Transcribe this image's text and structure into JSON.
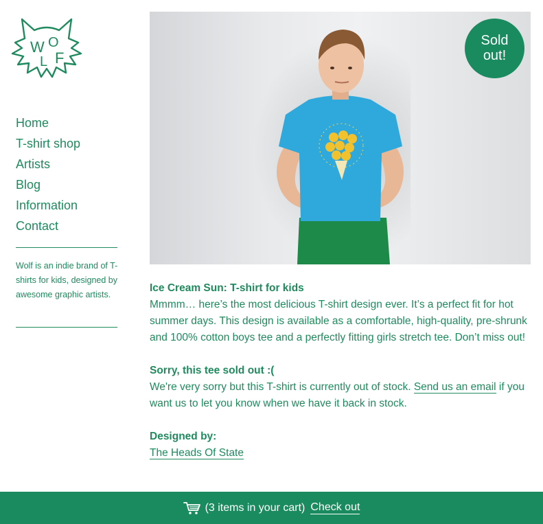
{
  "brand": {
    "logo_text": "WOLF",
    "logo_letters": [
      "W",
      "O",
      "L",
      "F"
    ],
    "tagline": "Wolf is an indie brand of T-shirts for kids, designed by awesome graphic artists.",
    "accent_color": "#1a8a5f"
  },
  "nav": {
    "items": [
      {
        "label": "Home"
      },
      {
        "label": "T-shirt shop"
      },
      {
        "label": "Artists"
      },
      {
        "label": "Blog"
      },
      {
        "label": "Information"
      },
      {
        "label": "Contact"
      }
    ]
  },
  "product": {
    "badge_line1": "Sold",
    "badge_line2": "out!",
    "title": "Ice Cream Sun: T-shirt for kids",
    "description": "Mmmm… here’s the most delicious T-shirt design ever. It’s a perfect fit for hot summer days. This design is available as a comfortable, high-quality, pre-shrunk and 100% cotton boys tee and a perfectly fitting girls stretch tee. Don’t miss out!",
    "soldout_heading": "Sorry, this tee sold out :(",
    "soldout_text_before": "We're very sorry but this T-shirt is currently out of stock. ",
    "soldout_link": "Send us an email",
    "soldout_text_after": " if you want us to let you know when we have it back in stock.",
    "designer_heading": "Designed by:",
    "designer_link": "The Heads Of State"
  },
  "cart": {
    "icon": "shopping-cart-icon",
    "summary": "(3 items in your cart)",
    "checkout_label": "Check out"
  }
}
